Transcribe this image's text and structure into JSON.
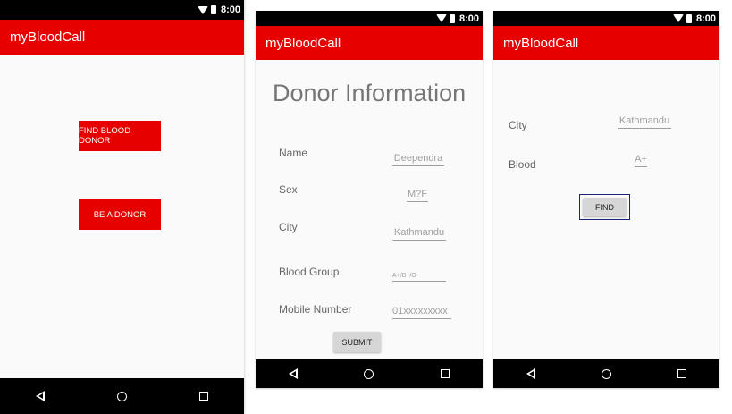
{
  "status_time": "8:00",
  "app_title": "myBloodCall",
  "screen1": {
    "find_donor_button": "FIND BLOOD DONOR",
    "be_donor_button": "BE A DONOR"
  },
  "screen2": {
    "heading": "Donor Information",
    "name_label": "Name",
    "name_value": "Deependra",
    "sex_label": "Sex",
    "sex_value": "M?F",
    "city_label": "City",
    "city_value": "Kathmandu",
    "blood_label": "Blood Group",
    "blood_hint": "A+/B+/O-",
    "mobile_label": "Mobile Number",
    "mobile_value": "01xxxxxxxxx",
    "submit_button": "SUBMIT"
  },
  "screen3": {
    "city_label": "City",
    "city_value": "Kathmandu",
    "blood_label": "Blood",
    "blood_value": "A+",
    "find_button": "FIND"
  }
}
